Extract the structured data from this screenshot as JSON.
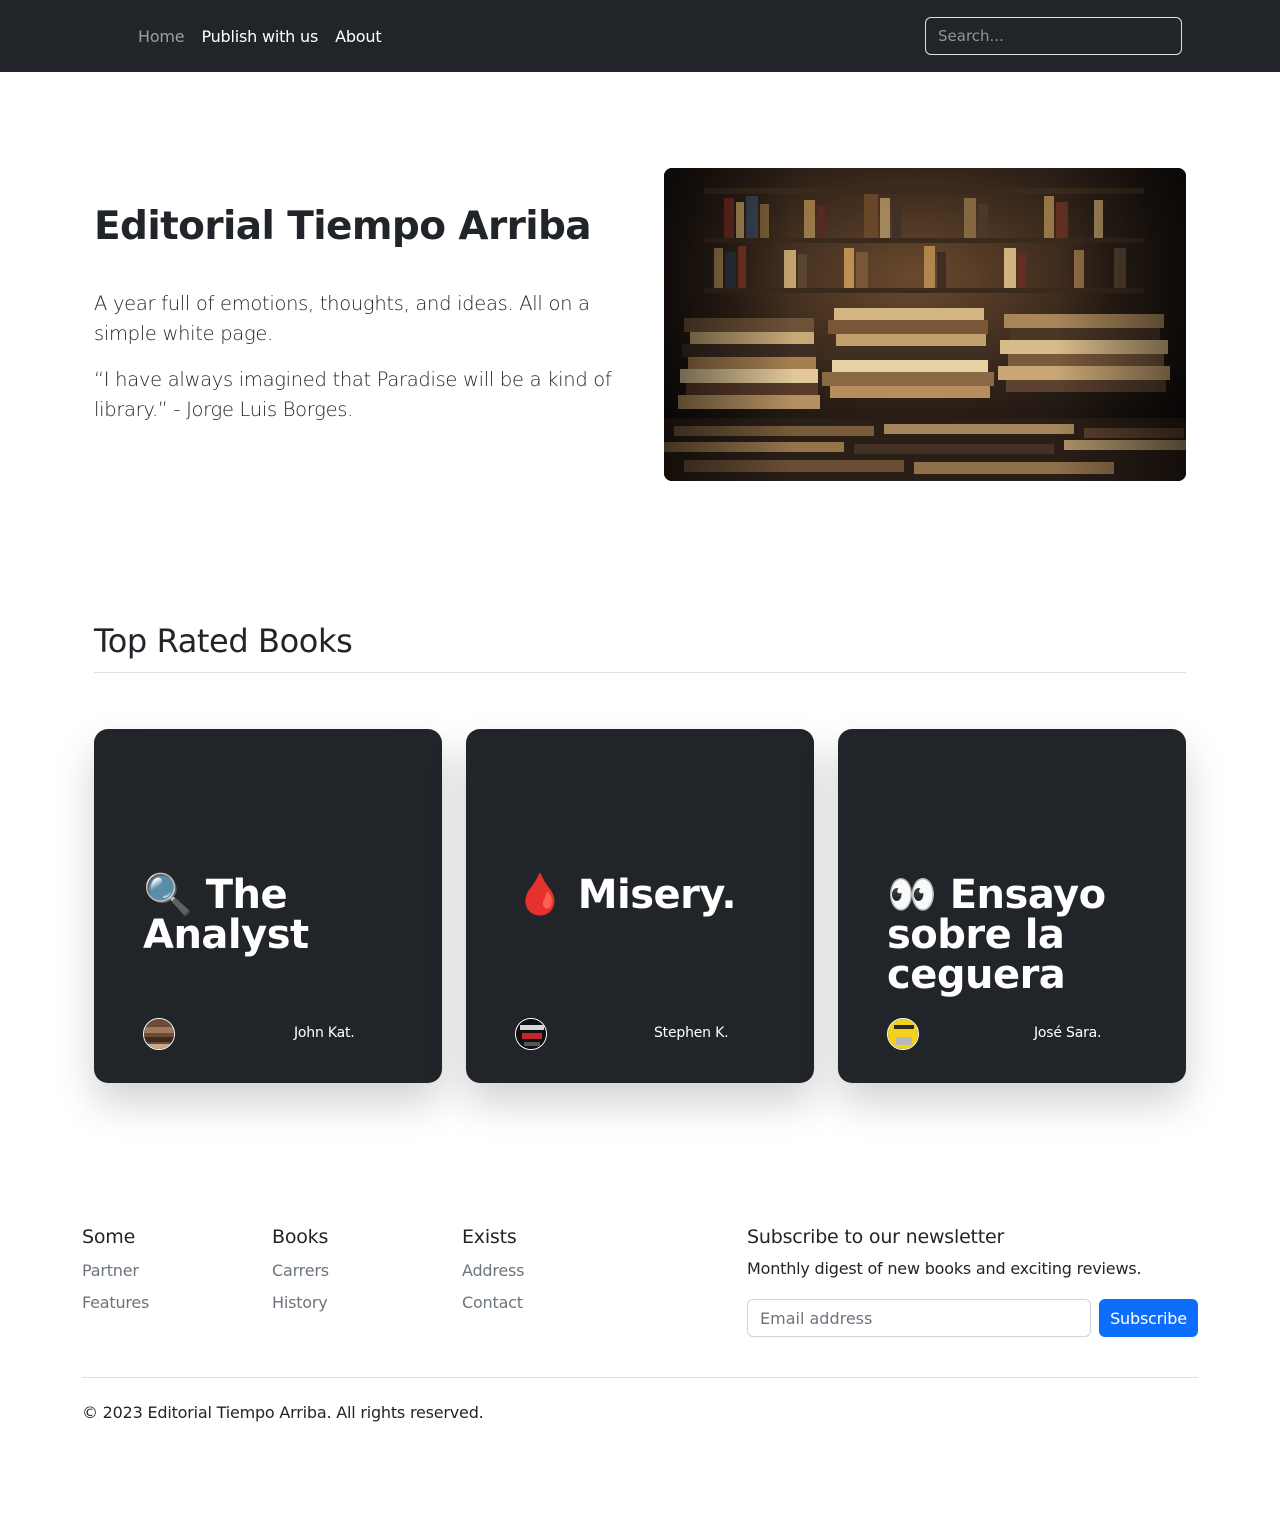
{
  "nav": {
    "links": [
      {
        "label": "Home",
        "active": true
      },
      {
        "label": "Publish with us",
        "active": false
      },
      {
        "label": "About",
        "active": false
      }
    ],
    "search_placeholder": "Search..."
  },
  "hero": {
    "title": "Editorial Tiempo Arriba",
    "lead": "A year full of emotions, thoughts, and ideas. All on a simple white page.",
    "quote": "“I have always imagined that Paradise will be a kind of library.” - Jorge Luis Borges.",
    "image": "bookstore-photo"
  },
  "top_rated": {
    "title": "Top Rated Books",
    "cards": [
      {
        "icon": "magnifying-glass-emoji",
        "title": "🔍 The Analyst",
        "author": "John Kat.",
        "avatar": "book-cover-avatar"
      },
      {
        "icon": "drop-of-blood-emoji",
        "title": "🩸 Misery.",
        "author": "Stephen K.",
        "avatar": "book-cover-avatar"
      },
      {
        "icon": "eyes-emoji",
        "title": "👀 Ensayo sobre la ceguera",
        "author": "José Sara.",
        "avatar": "book-cover-avatar"
      }
    ]
  },
  "footer": {
    "columns": [
      {
        "heading": "Some",
        "links": [
          "Partner",
          "Features"
        ]
      },
      {
        "heading": "Books",
        "links": [
          "Carrers",
          "History"
        ]
      },
      {
        "heading": "Exists",
        "links": [
          "Address",
          "Contact"
        ]
      }
    ],
    "newsletter": {
      "title": "Subscribe to our newsletter",
      "description": "Monthly digest of new books and exciting reviews.",
      "email_placeholder": "Email address",
      "button_label": "Subscribe"
    },
    "copyright": "© 2023 Editorial Tiempo Arriba. All rights reserved."
  },
  "colors": {
    "navbar_bg": "#212529",
    "card_bg": "#212529",
    "accent": "#0d6efd",
    "muted": "#6c757d"
  }
}
